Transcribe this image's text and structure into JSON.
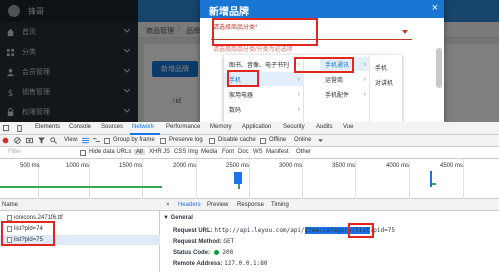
{
  "app": {
    "user_name": "锋哥",
    "sidebar": [
      {
        "label": "首页",
        "icon": "home-icon"
      },
      {
        "label": "分类",
        "icon": "grid-icon"
      },
      {
        "label": "会员管理",
        "icon": "users-icon"
      },
      {
        "label": "销售管理",
        "icon": "dollar-icon"
      },
      {
        "label": "权限管理",
        "icon": "lock-icon"
      }
    ],
    "breadcrumb": [
      "商品管理",
      "品牌管理"
    ],
    "add_button": "新增品牌",
    "id_column": "↑id"
  },
  "dialog": {
    "title": "新增品牌",
    "close": "×",
    "category_placeholder": "请选择商品分类*",
    "category_hint": "请选择商品分类/分类为必选项",
    "cascader": {
      "col1": [
        {
          "label": "图书、音像、电子书刊",
          "has_children": true
        },
        {
          "label": "手机",
          "has_children": true,
          "selected": true
        },
        {
          "label": "家用电器",
          "has_children": true
        },
        {
          "label": "数码",
          "has_children": true
        }
      ],
      "col2": [
        {
          "label": "手机通讯",
          "has_children": true,
          "selected": true
        },
        {
          "label": "运营商",
          "has_children": true
        },
        {
          "label": "手机配件",
          "has_children": true
        }
      ],
      "col3": [
        {
          "label": "手机"
        },
        {
          "label": "对讲机"
        }
      ]
    }
  },
  "devtools": {
    "tabs": [
      "Elements",
      "Console",
      "Sources",
      "Network",
      "Performance",
      "Memory",
      "Application",
      "Security",
      "Audits",
      "Vue"
    ],
    "active_tab": "Network",
    "toolbar": {
      "view_label": "View:",
      "group_by_frame": "Group by frame",
      "preserve_log": "Preserve log",
      "disable_cache": "Disable cache",
      "offline": "Offline",
      "throttle": "Online"
    },
    "filters": {
      "placeholder": "Filter",
      "hide_data_urls": "Hide data URLs",
      "types": [
        "All",
        "XHR",
        "JS",
        "CSS",
        "Img",
        "Media",
        "Font",
        "Doc",
        "WS",
        "Manifest",
        "Other"
      ]
    },
    "timeline_ticks": [
      "500 ms",
      "1000 ms",
      "1500 ms",
      "2000 ms",
      "2500 ms",
      "3000 ms",
      "3500 ms",
      "4000 ms",
      "4500 ms"
    ],
    "requests": {
      "header": "Name",
      "rows": [
        "ionicons.2471f6.ttf",
        "list?pid=74",
        "list?pid=75"
      ]
    },
    "detail": {
      "tabs": [
        "×",
        "Headers",
        "Preview",
        "Response",
        "Timing"
      ],
      "active_tab": "Headers",
      "section": "General",
      "request_url_label": "Request URL:",
      "request_url_prefix": "http://api.leyou.com/api/",
      "request_url_highlight": "item/category/list",
      "request_url_suffix": "?pid=75",
      "request_method_label": "Request Method:",
      "request_method": "GET",
      "status_code_label": "Status Code:",
      "status_code": "200",
      "remote_address_label": "Remote Address:",
      "remote_address": "127.0.0.1:80"
    }
  }
}
